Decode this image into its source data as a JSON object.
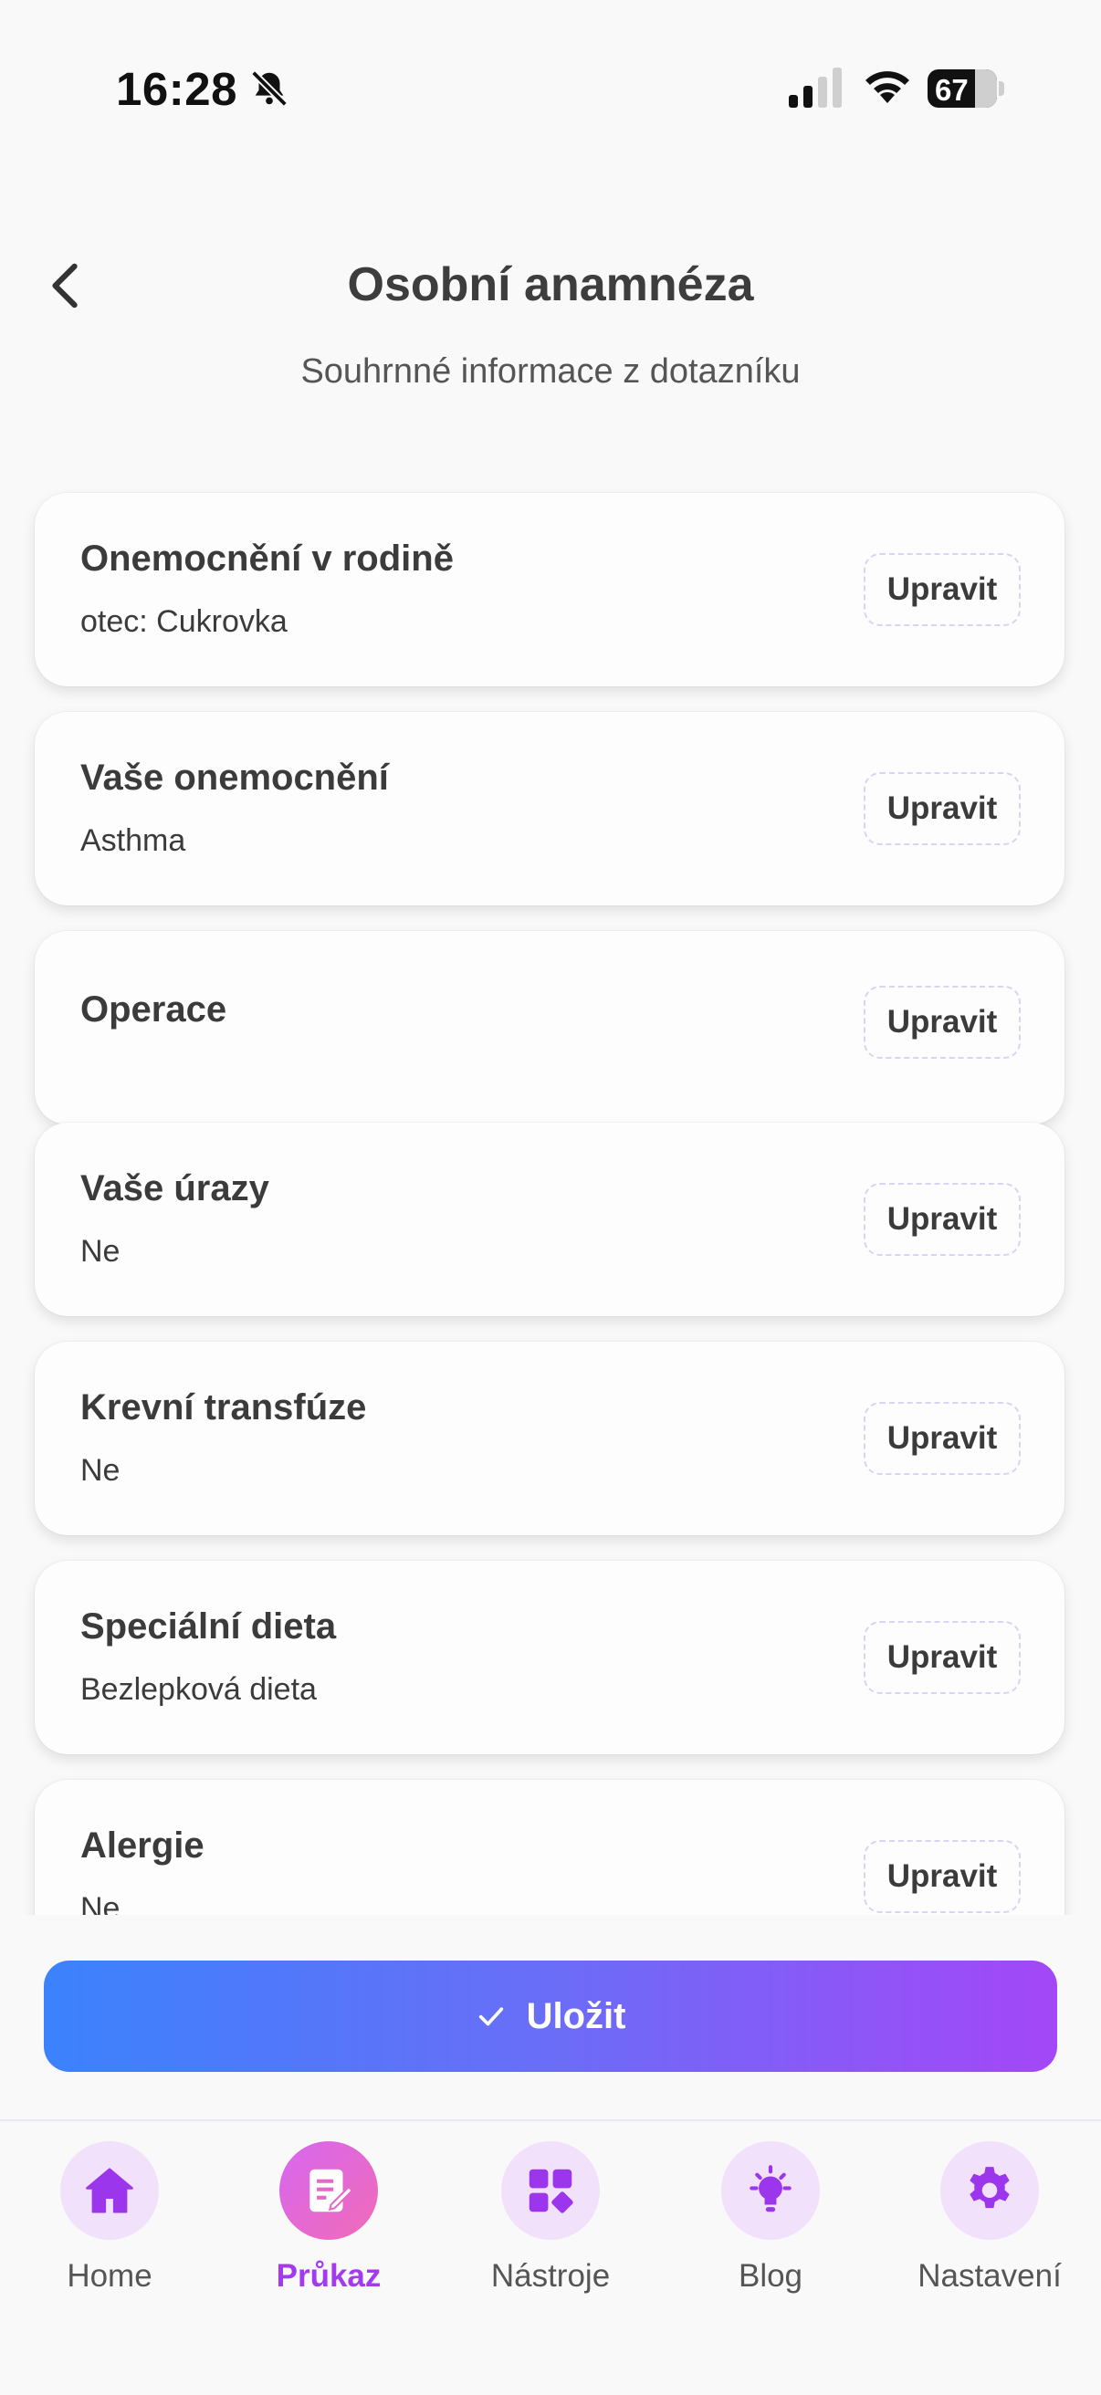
{
  "status_bar": {
    "time": "16:28",
    "battery": "67"
  },
  "header": {
    "title": "Osobní anamnéza",
    "subtitle": "Souhrnné informace z dotazníku"
  },
  "cards": [
    {
      "title": "Onemocnění v rodině",
      "value": "otec: Cukrovka",
      "button": "Upravit"
    },
    {
      "title": "Vaše onemocnění",
      "value": "Asthma",
      "button": "Upravit"
    },
    {
      "title": "Operace",
      "value": "",
      "button": "Upravit"
    },
    {
      "title": "Vaše úrazy",
      "value": "Ne",
      "button": "Upravit"
    },
    {
      "title": "Krevní transfúze",
      "value": "Ne",
      "button": "Upravit"
    },
    {
      "title": "Speciální dieta",
      "value": "Bezlepková dieta",
      "button": "Upravit"
    },
    {
      "title": "Alergie",
      "value": "Ne",
      "button": "Upravit"
    }
  ],
  "save_button": {
    "label": "Uložit"
  },
  "bottom_nav": [
    {
      "label": "Home",
      "icon": "home-icon",
      "active": false
    },
    {
      "label": "Průkaz",
      "icon": "medical-card-icon",
      "active": true
    },
    {
      "label": "Nástroje",
      "icon": "tools-grid-icon",
      "active": false
    },
    {
      "label": "Blog",
      "icon": "lightbulb-icon",
      "active": false
    },
    {
      "label": "Nastavení",
      "icon": "gear-icon",
      "active": false
    }
  ],
  "colors": {
    "accent_purple": "#a23bf0",
    "gradient_start": "#3b82fc",
    "gradient_end": "#a447f7",
    "nav_icon_bg": "#f1e1fb"
  }
}
